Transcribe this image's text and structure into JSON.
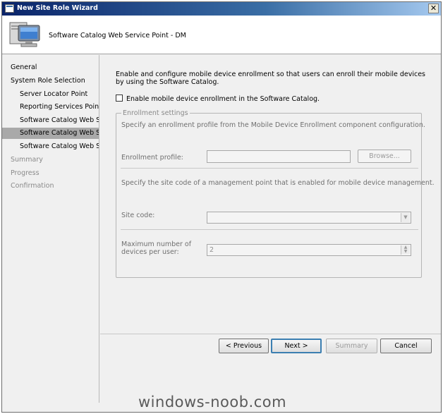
{
  "window": {
    "title": "New Site Role Wizard",
    "close_glyph": "✕"
  },
  "header": {
    "heading": "Software Catalog Web Service Point - DM",
    "icon": "computer-icon"
  },
  "sidebar": {
    "items": [
      {
        "label": "General",
        "state": "normal"
      },
      {
        "label": "System Role Selection",
        "state": "normal"
      },
      {
        "label": "Server Locator Point",
        "state": "normal"
      },
      {
        "label": "Reporting Services Point",
        "state": "normal"
      },
      {
        "label": "Software Catalog Web Ser",
        "state": "normal"
      },
      {
        "label": "Software Catalog Web Ser",
        "state": "selected"
      },
      {
        "label": "Software Catalog Web Site",
        "state": "normal"
      },
      {
        "label": "Summary",
        "state": "disabled"
      },
      {
        "label": "Progress",
        "state": "disabled"
      },
      {
        "label": "Confirmation",
        "state": "disabled"
      }
    ]
  },
  "main": {
    "intro": "Enable and configure mobile device enrollment so that users can enroll their mobile devices by using the Software Catalog.",
    "enable_checkbox_label": "Enable mobile device enrollment in the Software Catalog.",
    "enable_checked": false,
    "group": {
      "legend": "Enrollment settings",
      "profile_desc": "Specify an enrollment profile from the Mobile Device Enrollment component configuration.",
      "profile_label": "Enrollment profile:",
      "profile_value": "",
      "browse_label": "Browse...",
      "site_desc": "Specify the site code of a management point that is enabled for mobile device management.",
      "site_label": "Site code:",
      "site_value": "",
      "max_label_line1": "Maximum number of",
      "max_label_line2": "devices per user:",
      "max_value": "2"
    }
  },
  "footer": {
    "previous_label": "< Previous",
    "next_label": "Next >",
    "summary_label": "Summary",
    "cancel_label": "Cancel"
  },
  "watermark": "windows-noob.com"
}
